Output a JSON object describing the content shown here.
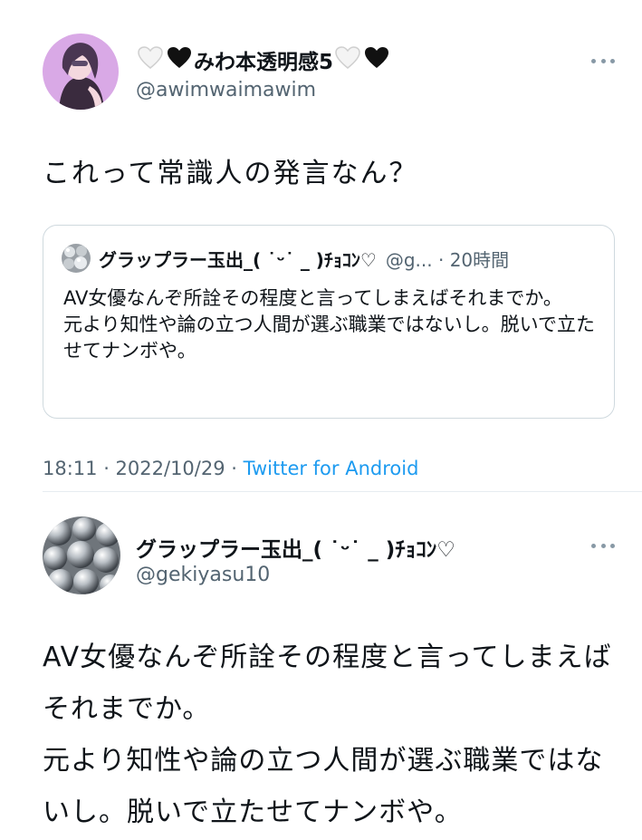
{
  "tweet": {
    "author": {
      "display_name": "みわ本透明感5",
      "handle": "@awimwaimawim",
      "name_decorations": {
        "leading": [
          "white-heart-icon",
          "black-heart-icon"
        ],
        "trailing": [
          "white-heart-icon",
          "black-heart-icon"
        ]
      }
    },
    "text": "これって常識人の発言なん？",
    "timestamp": "18:11 · 2022/10/29 · ",
    "source": "Twitter for Android"
  },
  "quoted_tweet": {
    "display_name": "グラップラー玉出_( ˙ᵕ˙ _ )ﾁｮｺﾝ♡",
    "handle_and_time": "@g... · 20時間",
    "text": "AV女優なんぞ所詮その程度と言ってしまえばそれまでか。\n元より知性や論の立つ人間が選ぶ職業ではないし。脱いで立たせてナンボや。"
  },
  "reply_tweet": {
    "author": {
      "display_name": "グラップラー玉出_( ˙ᵕ˙ _ )ﾁｮｺﾝ♡",
      "handle": "@gekiyasu10"
    },
    "text": "AV女優なんぞ所詮その程度と言ってしまえばそれまでか。\n元より知性や論の立つ人間が選ぶ職業ではないし。脱いで立たせてナンボや。"
  },
  "colors": {
    "text_primary": "#0f1419",
    "text_secondary": "#536471",
    "link": "#1d9bf0",
    "border": "#cfd9de"
  }
}
